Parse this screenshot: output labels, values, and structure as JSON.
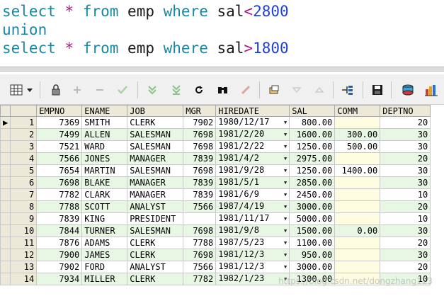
{
  "editor": {
    "lines": [
      [
        {
          "t": "select",
          "c": "kw"
        },
        {
          "t": " ",
          "c": "tx"
        },
        {
          "t": "*",
          "c": "op"
        },
        {
          "t": " ",
          "c": "tx"
        },
        {
          "t": "from",
          "c": "kw"
        },
        {
          "t": " emp ",
          "c": "tx"
        },
        {
          "t": "where",
          "c": "kw"
        },
        {
          "t": " sal",
          "c": "tx"
        },
        {
          "t": "<",
          "c": "op"
        },
        {
          "t": "2800",
          "c": "nm"
        }
      ],
      [
        {
          "t": "union",
          "c": "kw"
        }
      ],
      [
        {
          "t": "select",
          "c": "kw"
        },
        {
          "t": " ",
          "c": "tx"
        },
        {
          "t": "*",
          "c": "op"
        },
        {
          "t": " ",
          "c": "tx"
        },
        {
          "t": "from",
          "c": "kw"
        },
        {
          "t": " emp ",
          "c": "tx"
        },
        {
          "t": "where",
          "c": "kw"
        },
        {
          "t": " sal",
          "c": "tx"
        },
        {
          "t": ">",
          "c": "op"
        },
        {
          "t": "1800",
          "c": "nm"
        }
      ]
    ]
  },
  "toolbar": {
    "icons": [
      "grid-view-icon",
      "dropdown-arrow-icon",
      "lock-icon",
      "add-record-icon",
      "delete-record-icon",
      "post-changes-icon",
      "fetch-next-icon",
      "fetch-last-icon",
      "refresh-icon",
      "find-icon",
      "clear-icon",
      "query-by-example-icon",
      "sort-ascending-icon",
      "sort-descending-icon",
      "filter-icon",
      "save-icon",
      "export-icon",
      "chart-icon"
    ]
  },
  "grid": {
    "columns": [
      "EMPNO",
      "ENAME",
      "JOB",
      "MGR",
      "HIREDATE",
      "SAL",
      "COMM",
      "DEPTNO"
    ],
    "rows": [
      [
        "1",
        "7369",
        "SMITH",
        "CLERK",
        "7902",
        "1980/12/17",
        "800.00",
        "",
        "20"
      ],
      [
        "2",
        "7499",
        "ALLEN",
        "SALESMAN",
        "7698",
        "1981/2/20",
        "1600.00",
        "300.00",
        "30"
      ],
      [
        "3",
        "7521",
        "WARD",
        "SALESMAN",
        "7698",
        "1981/2/22",
        "1250.00",
        "500.00",
        "30"
      ],
      [
        "4",
        "7566",
        "JONES",
        "MANAGER",
        "7839",
        "1981/4/2",
        "2975.00",
        "",
        "20"
      ],
      [
        "5",
        "7654",
        "MARTIN",
        "SALESMAN",
        "7698",
        "1981/9/28",
        "1250.00",
        "1400.00",
        "30"
      ],
      [
        "6",
        "7698",
        "BLAKE",
        "MANAGER",
        "7839",
        "1981/5/1",
        "2850.00",
        "",
        "30"
      ],
      [
        "7",
        "7782",
        "CLARK",
        "MANAGER",
        "7839",
        "1981/6/9",
        "2450.00",
        "",
        "10"
      ],
      [
        "8",
        "7788",
        "SCOTT",
        "ANALYST",
        "7566",
        "1987/4/19",
        "3000.00",
        "",
        "20"
      ],
      [
        "9",
        "7839",
        "KING",
        "PRESIDENT",
        "",
        "1981/11/17",
        "5000.00",
        "",
        "10"
      ],
      [
        "10",
        "7844",
        "TURNER",
        "SALESMAN",
        "7698",
        "1981/9/8",
        "1500.00",
        "0.00",
        "30"
      ],
      [
        "11",
        "7876",
        "ADAMS",
        "CLERK",
        "7788",
        "1987/5/23",
        "1100.00",
        "",
        "20"
      ],
      [
        "12",
        "7900",
        "JAMES",
        "CLERK",
        "7698",
        "1981/12/3",
        "950.00",
        "",
        "30"
      ],
      [
        "13",
        "7902",
        "FORD",
        "ANALYST",
        "7566",
        "1981/12/3",
        "3000.00",
        "",
        "20"
      ],
      [
        "14",
        "7934",
        "MILLER",
        "CLERK",
        "7782",
        "1982/1/23",
        "1300.00",
        "",
        "10"
      ]
    ],
    "current_row_indicator": "▶",
    "colors": {
      "alt_row": "#e7f7e4",
      "null_comm": "#fdfbe0",
      "header": "#ece9d8"
    }
  },
  "watermark": "https://blog.csdn.net/dongzhang123"
}
